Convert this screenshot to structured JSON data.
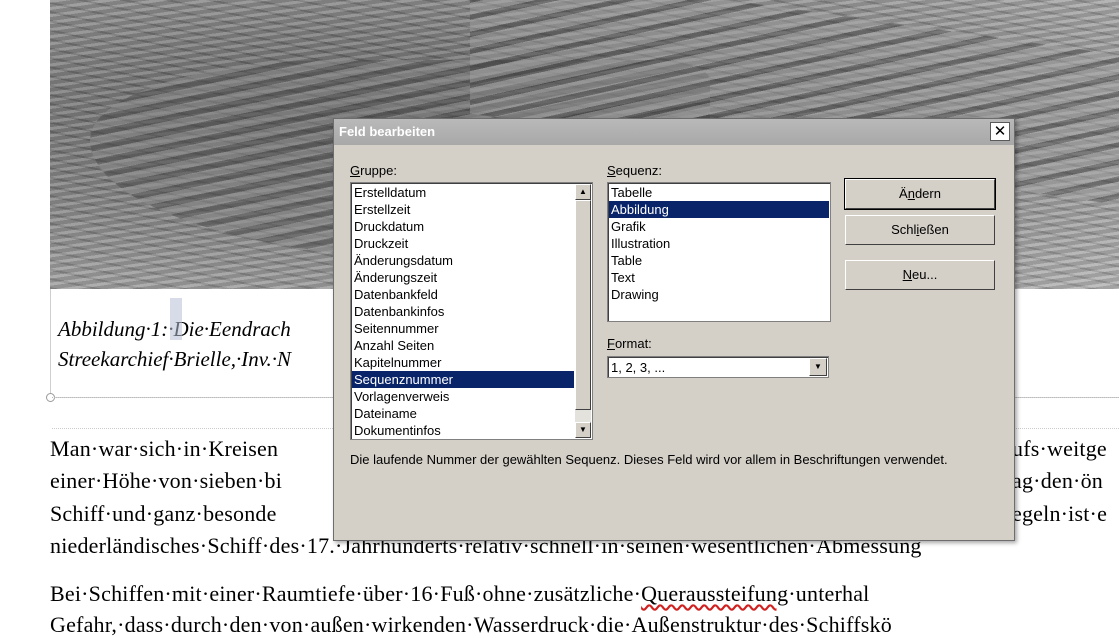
{
  "document": {
    "caption_line1": "Abbildung·1:·Die·Eendrach",
    "caption_line2": "Streekarchief·Brielle,·Inv.·N",
    "para1": [
      {
        "left": "Man·war·sich·in·Kreisen",
        "right": "ufs·weitge"
      },
      {
        "left": "einer·Höhe·von·sieben·bi",
        "right": "ag·den·ön"
      },
      {
        "left": "Schiff·und·ganz·besonde",
        "right": "egeln·ist·e"
      },
      {
        "left": "niederländisches·Schiff·des·17.·Jahrhunderts·relativ·schnell·in·seinen·wesentlichen·Abmessung",
        "right": ""
      }
    ],
    "para2_line1_a": "Bei·Schiffen·mit·einer·Raumtiefe·über·16·Fuß·ohne·zusätzliche·",
    "para2_line1_wavy": "Queraussteifung",
    "para2_line1_b": "·unterhal",
    "para2_line2": "Gefahr,·dass·durch·den·von·außen·wirkenden·Wasserdruck·die·Außenstruktur·des·Schiffskö"
  },
  "dialog": {
    "title": "Feld bearbeiten",
    "close_label": "✕",
    "gruppe_label_u": "G",
    "gruppe_label_rest": "ruppe:",
    "gruppe_items": [
      "Erstelldatum",
      "Erstellzeit",
      "Druckdatum",
      "Druckzeit",
      "Änderungsdatum",
      "Änderungszeit",
      "Datenbankfeld",
      "Datenbankinfos",
      "Seitennummer",
      "Anzahl Seiten",
      "Kapitelnummer",
      "Sequenznummer",
      "Vorlagenverweis",
      "Dateiname",
      "Dokumentinfos"
    ],
    "gruppe_selected": "Sequenznummer",
    "sequenz_label_u": "S",
    "sequenz_label_rest": "equenz:",
    "sequenz_items": [
      "Tabelle",
      "Abbildung",
      "Grafik",
      "Illustration",
      "Table",
      "Text",
      "Drawing"
    ],
    "sequenz_selected": "Abbildung",
    "format_label_u": "F",
    "format_label_rest": "ormat:",
    "format_value": "1, 2, 3, ...",
    "btn_aendern_pre": "Ä",
    "btn_aendern_u": "n",
    "btn_aendern_post": "dern",
    "btn_schliessen_pre": "Schl",
    "btn_schliessen_u": "i",
    "btn_schliessen_post": "eßen",
    "btn_neu_u": "N",
    "btn_neu_post": "eu...",
    "help_text": "Die laufende Nummer der gewählten Sequenz. Dieses Feld wird vor allem in Beschriftungen verwendet."
  },
  "colors": {
    "selection": "#0a246a",
    "dialog_bg": "#d4d0c8",
    "titlebar": "#a8a8a8",
    "spellcheck_underline": "#d02020"
  }
}
